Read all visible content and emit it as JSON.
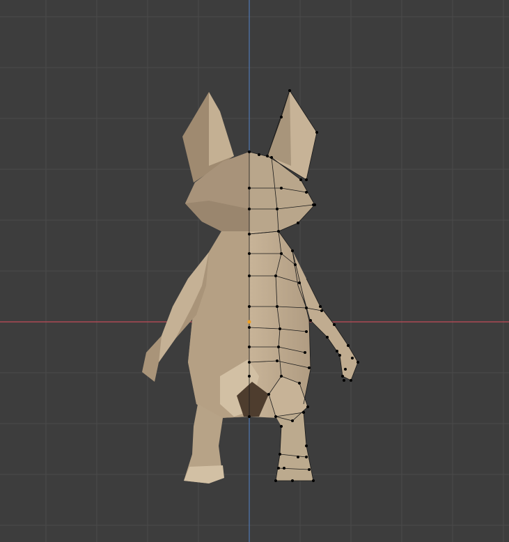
{
  "viewport": {
    "view": "front-orthographic",
    "mode": "edit-mode-mesh",
    "background_color": "#3d3d3d",
    "grid_color": "#4a4a4a",
    "x_axis_color": "#c24d58",
    "z_axis_color": "#4f78b4",
    "mesh_color": "#b8a58c",
    "wire_color": "#1a1a1a",
    "vertex_color": "#000000",
    "origin_color": "#f0a020",
    "icons": [
      "object-origin-icon"
    ]
  }
}
